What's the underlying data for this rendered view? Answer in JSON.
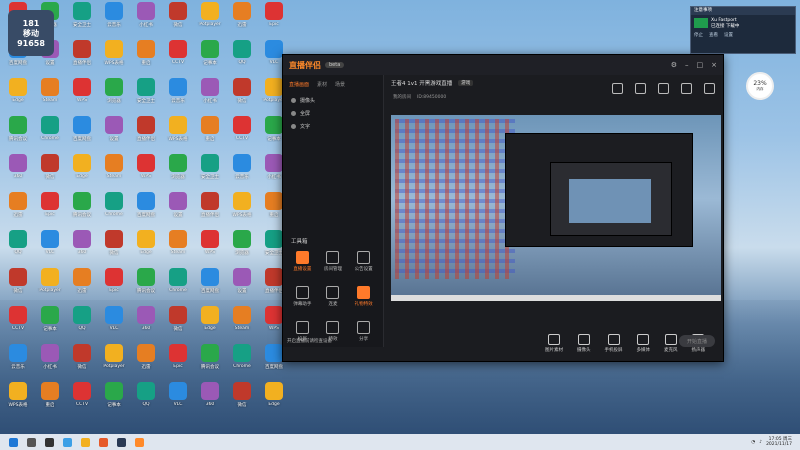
{
  "desktop": {
    "avatar_lines": [
      "181",
      "移动",
      "91658"
    ],
    "icons": [
      "WPS",
      "百度网盘",
      "Edge",
      "腾讯会议",
      "360",
      "迅雷",
      "QQ",
      "微信",
      "CCTV",
      "云音乐",
      "WPS表格",
      "浏览器",
      "设置",
      "Steam",
      "Chrome",
      "微信",
      "Epic",
      "VLC",
      "Potplayer",
      "记事本",
      "小红书",
      "重启",
      "安全卫士",
      "直播伴侣"
    ]
  },
  "window": {
    "logo": "直播伴侣",
    "beta": "beta",
    "sidebar_tabs": [
      "直播画面",
      "素材",
      "场景"
    ],
    "scenes": [
      "摄像头",
      "全屏",
      "文字"
    ],
    "tool_title": "工具箱",
    "tools": [
      "直播设置",
      "房间管理",
      "公告设置",
      "弹幕助手",
      "连麦",
      "礼物特效",
      "投屏",
      "特效",
      "分享"
    ],
    "bottom_note": "开启直播前请检查设备",
    "stream_title": "王者4 1v1 开黑游戏直播",
    "stream_tag": "游戏",
    "room_line": "我的房间",
    "room_id": "ID:89450000",
    "controls": [
      "图片素材",
      "摄像头",
      "手机投屏",
      "多媒体",
      "麦克风",
      "扬声器"
    ],
    "golive": "开始直播"
  },
  "notify": {
    "head": "注意事项",
    "name": "Xu Fastport",
    "line": "已连接 下载中",
    "actions": [
      "停止",
      "查看",
      "设置"
    ]
  },
  "widget": {
    "pct": "23%",
    "sub": "内存"
  },
  "taskbar": {
    "time": "17:05 周三",
    "date": "2021/11/17"
  }
}
